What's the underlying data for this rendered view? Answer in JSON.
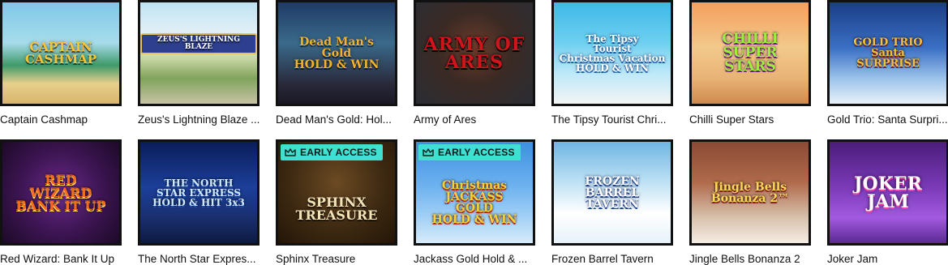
{
  "games": [
    {
      "title": "Captain Cashmap",
      "logo": "CAPTAIN\nCASHMAP",
      "badge": ""
    },
    {
      "title": "Zeus's Lightning Blaze ...",
      "logo": "ZEUS'S LIGHTNING BLAZE",
      "badge": ""
    },
    {
      "title": "Dead Man's Gold: Hol...",
      "logo": "Dead Man's\nGold\nHOLD & WIN",
      "badge": ""
    },
    {
      "title": "Army of Ares",
      "logo": "ARMY OF\nARES",
      "badge": ""
    },
    {
      "title": "The Tipsy Tourist Chri...",
      "logo": "The Tipsy\nTourist\nChristmas Vacation\nHOLD & WIN",
      "badge": ""
    },
    {
      "title": "Chilli Super Stars",
      "logo": "CHILLI\nSUPER\nSTARS",
      "badge": ""
    },
    {
      "title": "Gold Trio: Santa Surpri...",
      "logo": "GOLD TRIO\nSanta\nSURPRISE",
      "badge": ""
    },
    {
      "title": "Red Wizard: Bank It Up",
      "logo": "RED\nWIZARD\nBANK IT UP",
      "badge": ""
    },
    {
      "title": "The North Star Expres...",
      "logo": "THE NORTH\nSTAR EXPRESS\nHOLD & HIT 3x3",
      "badge": ""
    },
    {
      "title": "Sphinx Treasure",
      "logo": "SPHINX\nTREASURE",
      "badge": "EARLY ACCESS"
    },
    {
      "title": "Jackass Gold Hold & ...",
      "logo": "Christmas\nJACKASS\nGOLD\nHOLD & WIN",
      "badge": "EARLY ACCESS"
    },
    {
      "title": "Frozen Barrel Tavern",
      "logo": "FROZEN\nBARREL\nTAVERN",
      "badge": ""
    },
    {
      "title": "Jingle Bells Bonanza 2",
      "logo": "Jingle Bells\nBonanza 2™",
      "badge": ""
    },
    {
      "title": "Joker Jam",
      "logo": "JOKER\nJAM",
      "badge": ""
    }
  ],
  "colors": {
    "badge_bg": "#3fe0d0",
    "frame": "#111111",
    "title_text": "#111111"
  },
  "icons": {
    "badge_icon": "crown-icon"
  }
}
